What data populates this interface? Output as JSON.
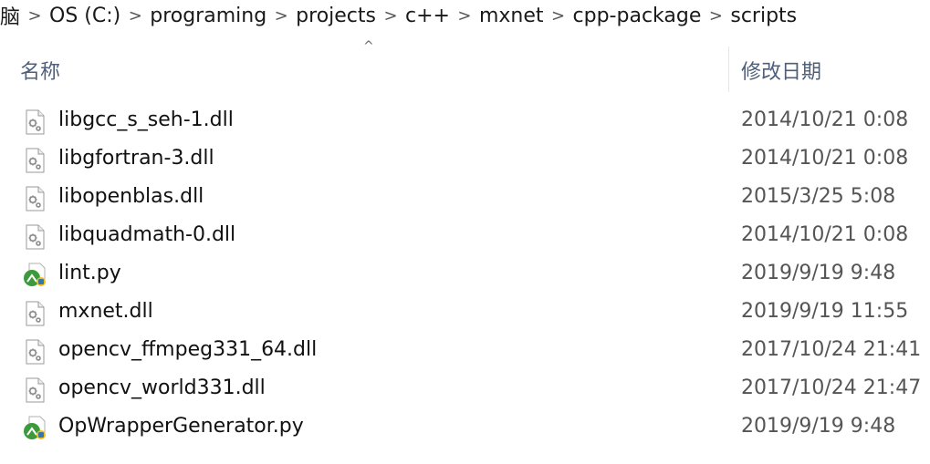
{
  "breadcrumb": {
    "items": [
      "脑",
      "OS (C:)",
      "programing",
      "projects",
      "c++",
      "mxnet",
      "cpp-package",
      "scripts"
    ],
    "separator": ">"
  },
  "columns": {
    "name": "名称",
    "date": "修改日期",
    "sort_indicator": "^"
  },
  "files": [
    {
      "name": "libgcc_s_seh-1.dll",
      "date": "2014/10/21 0:08",
      "icon": "dll-file-icon"
    },
    {
      "name": "libgfortran-3.dll",
      "date": "2014/10/21 0:08",
      "icon": "dll-file-icon"
    },
    {
      "name": "libopenblas.dll",
      "date": "2015/3/25 5:08",
      "icon": "dll-file-icon"
    },
    {
      "name": "libquadmath-0.dll",
      "date": "2014/10/21 0:08",
      "icon": "dll-file-icon"
    },
    {
      "name": "lint.py",
      "date": "2019/9/19 9:48",
      "icon": "python-file-icon"
    },
    {
      "name": "mxnet.dll",
      "date": "2019/9/19 11:55",
      "icon": "dll-file-icon"
    },
    {
      "name": "opencv_ffmpeg331_64.dll",
      "date": "2017/10/24 21:41",
      "icon": "dll-file-icon"
    },
    {
      "name": "opencv_world331.dll",
      "date": "2017/10/24 21:47",
      "icon": "dll-file-icon"
    },
    {
      "name": "OpWrapperGenerator.py",
      "date": "2019/9/19 9:48",
      "icon": "python-file-icon"
    }
  ]
}
